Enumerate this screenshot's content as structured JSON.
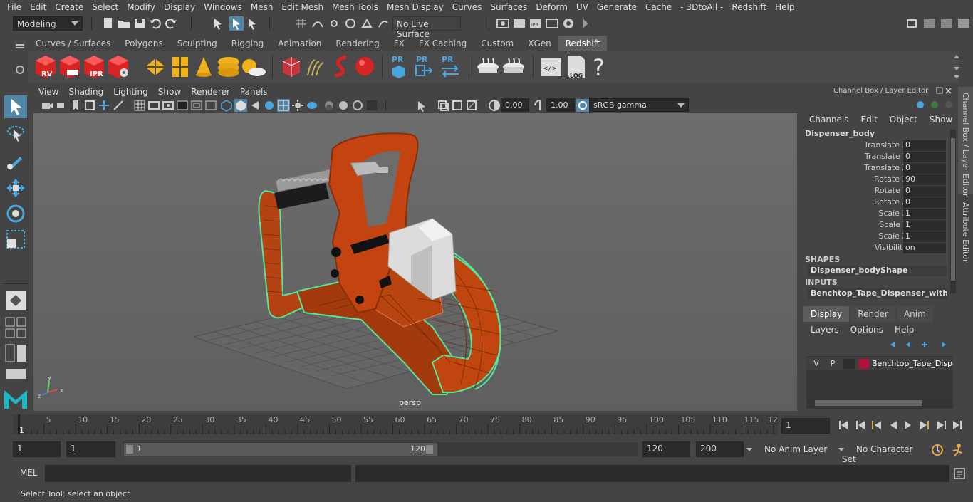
{
  "menubar": [
    "File",
    "Edit",
    "Create",
    "Select",
    "Modify",
    "Display",
    "Windows",
    "Mesh",
    "Edit Mesh",
    "Mesh Tools",
    "Mesh Display",
    "Curves",
    "Surfaces",
    "Deform",
    "UV",
    "Generate",
    "Cache",
    "- 3DtoAll -",
    "Redshift",
    "Help"
  ],
  "status": {
    "mode": "Modeling",
    "live_surface": "No Live Surface"
  },
  "shelf_tabs": [
    "Curves / Surfaces",
    "Polygons",
    "Sculpting",
    "Rigging",
    "Animation",
    "Rendering",
    "FX",
    "FX Caching",
    "Custom",
    "XGen",
    "Redshift"
  ],
  "shelf_active": "Redshift",
  "shelf_icon_labels": {
    "rv": "RV",
    "ipr": "IPR",
    "pr1": "PR",
    "pr2": "PR",
    "pr3": "PR",
    "log": ".LOG",
    "help": "?"
  },
  "viewport": {
    "menu": [
      "View",
      "Shading",
      "Lighting",
      "Show",
      "Renderer",
      "Panels"
    ],
    "exposure": "0.00",
    "gamma": "1.00",
    "colorspace": "sRGB gamma",
    "camera_label": "persp",
    "axis_x": "x",
    "axis_y": "y",
    "axis_z": "z"
  },
  "channelbox": {
    "title": "Channel Box / Layer Editor",
    "menu": [
      "Channels",
      "Edit",
      "Object",
      "Show"
    ],
    "object": "Dispenser_body",
    "attrs": [
      {
        "label": "Translate X",
        "value": "0"
      },
      {
        "label": "Translate Y",
        "value": "0"
      },
      {
        "label": "Translate Z",
        "value": "0"
      },
      {
        "label": "Rotate X",
        "value": "90"
      },
      {
        "label": "Rotate Y",
        "value": "0"
      },
      {
        "label": "Rotate Z",
        "value": "0"
      },
      {
        "label": "Scale X",
        "value": "1"
      },
      {
        "label": "Scale Y",
        "value": "1"
      },
      {
        "label": "Scale Z",
        "value": "1"
      },
      {
        "label": "Visibility",
        "value": "on"
      }
    ],
    "shapes_header": "SHAPES",
    "shape": "Dispenser_bodyShape",
    "inputs_header": "INPUTS",
    "input": "Benchtop_Tape_Dispenser_with_S..."
  },
  "layer_editor": {
    "tabs": [
      "Display",
      "Render",
      "Anim"
    ],
    "active_tab": "Display",
    "menu": [
      "Layers",
      "Options",
      "Help"
    ],
    "layer": {
      "v": "V",
      "p": "P",
      "name": "Benchtop_Tape_Dispenser",
      "color": "#b0123a"
    }
  },
  "side_tabs": [
    "Channel Box / Layer Editor",
    "Attribute Editor"
  ],
  "timeline": {
    "ticks": [
      "1",
      "5",
      "10",
      "15",
      "20",
      "25",
      "30",
      "35",
      "40",
      "45",
      "50",
      "55",
      "60",
      "65",
      "70",
      "75",
      "80",
      "85",
      "90",
      "95",
      "100",
      "105",
      "110",
      "115",
      "12"
    ],
    "current_frame": "1"
  },
  "range": {
    "start": "1",
    "start2": "1",
    "slider_start": "1",
    "slider_end": "120",
    "end": "120",
    "end2": "200",
    "anim_layer": "No Anim Layer",
    "char_set": "No Character Set"
  },
  "cmd": {
    "label": "MEL"
  },
  "help": "Select Tool: select an object",
  "colors": {
    "accent": "#5285a6",
    "selection_wire": "#56e69a",
    "orange_body": "#c0420d"
  }
}
